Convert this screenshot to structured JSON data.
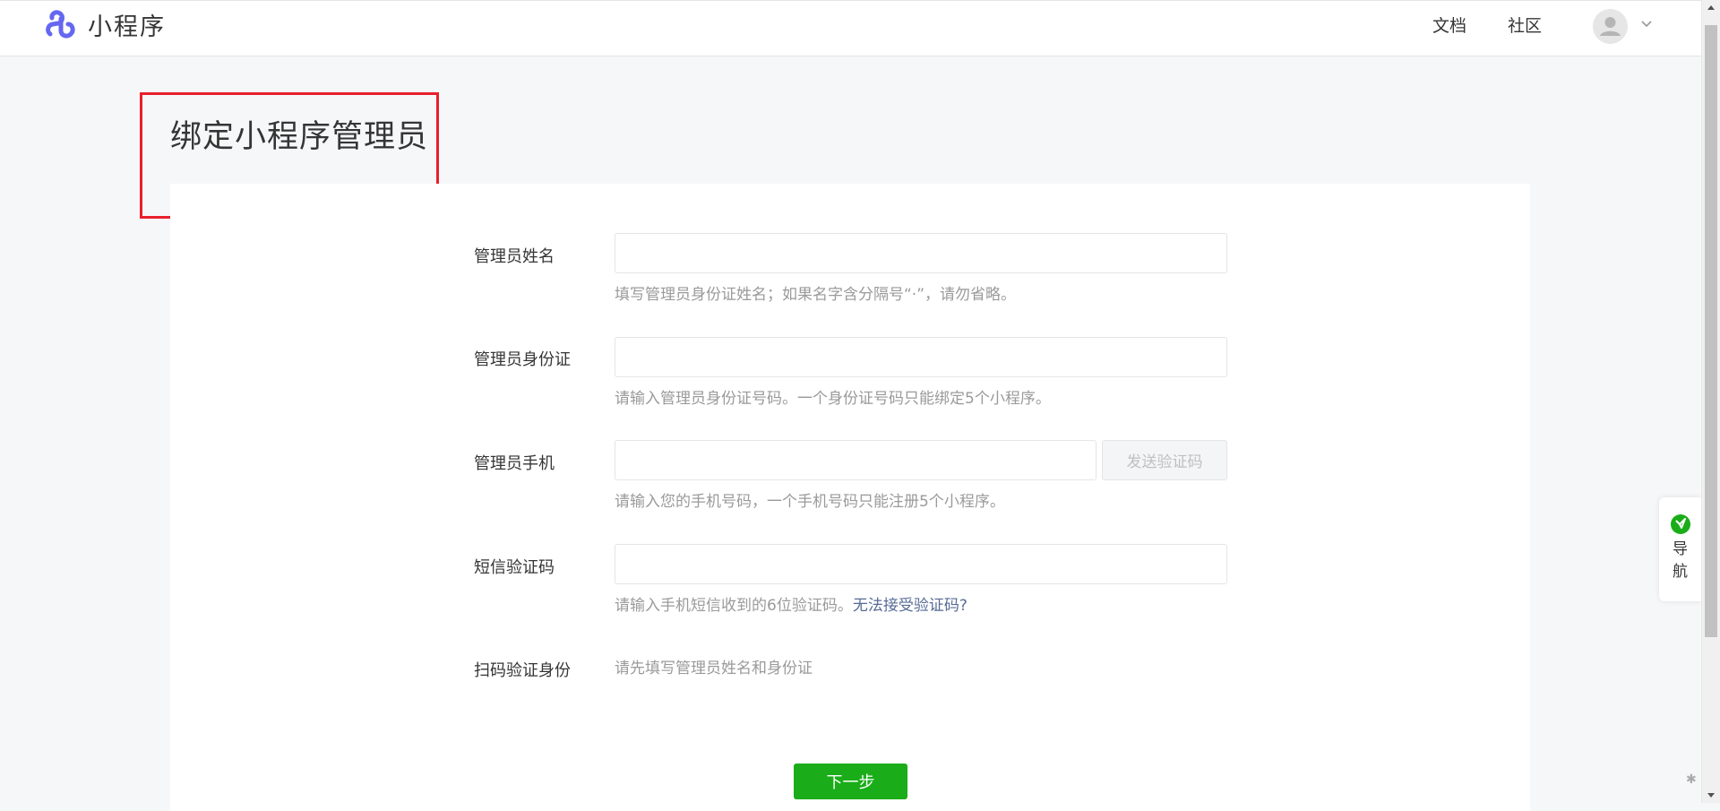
{
  "header": {
    "logo_text": "小程序",
    "nav": {
      "docs": "文档",
      "community": "社区"
    }
  },
  "page": {
    "title": "绑定小程序管理员"
  },
  "form": {
    "admin_name": {
      "label": "管理员姓名",
      "value": "",
      "hint": "填写管理员身份证姓名；如果名字含分隔号“·”，请勿省略。"
    },
    "admin_id": {
      "label": "管理员身份证",
      "value": "",
      "hint": "请输入管理员身份证号码。一个身份证号码只能绑定5个小程序。"
    },
    "admin_phone": {
      "label": "管理员手机",
      "value": "",
      "send_code_label": "发送验证码",
      "hint": "请输入您的手机号码，一个手机号码只能注册5个小程序。"
    },
    "sms_code": {
      "label": "短信验证码",
      "value": "",
      "hint": "请输入手机短信收到的6位验证码。",
      "hint_link": "无法接受验证码?"
    },
    "scan_verify": {
      "label": "扫码验证身份",
      "note": "请先填写管理员姓名和身份证"
    },
    "next_label": "下一步"
  },
  "float_nav": {
    "label": "导航"
  },
  "colors": {
    "brand_purple": "#6467f0",
    "primary_green": "#1aad19",
    "link_blue": "#576b95",
    "highlight_red": "#e8202c"
  },
  "icons": {
    "logo": "mini-program-logo-icon",
    "avatar": "user-avatar-icon",
    "caret": "chevron-down-icon",
    "float_nav": "compass-icon"
  }
}
